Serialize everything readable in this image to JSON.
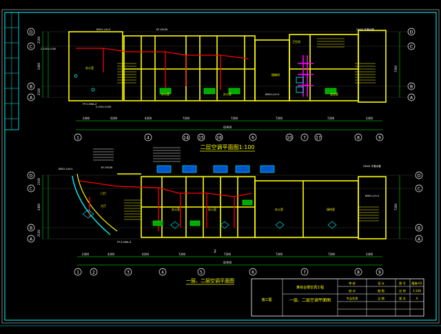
{
  "colors": {
    "background": "#000000",
    "frame": "#00ffff",
    "wall": "#ffff00",
    "dim": "#00ff00",
    "pipe_red": "#ff0000",
    "pipe_magenta": "#ff00ff",
    "fixture_cyan": "#00ffff",
    "text_white": "#ffffff"
  },
  "titles": {
    "upper_plan": "二层空调平面图1:100",
    "lower_plan": "一层、二层空调平面图"
  },
  "title_block": {
    "project_name": "某综合楼空调工程",
    "drawing_title": "一层、二层空调平面图",
    "stamp": "施工图",
    "rows": [
      [
        "审 核",
        "设 计",
        "图 号"
      ],
      [
        "校 对",
        "制 图",
        "比 例"
      ],
      [
        "专业负责",
        "日 期",
        "版 次"
      ]
    ],
    "values": [
      "暖施-02",
      "1:100",
      "A"
    ]
  },
  "upper": {
    "rows": [
      "D",
      "C",
      "B",
      "A"
    ],
    "cols": [
      "1",
      "4",
      "5",
      "6",
      "8",
      "9",
      "10",
      "11",
      "12"
    ],
    "col_lefts": [
      "14",
      "15",
      "16",
      "17"
    ],
    "dims": [
      "2400",
      "4200",
      "4200",
      "7200",
      "7200",
      "7200",
      "7200",
      "3300",
      "3300"
    ],
    "total": "42900",
    "side_dims": [
      "2100",
      "2400",
      "2100",
      "7200",
      "2400",
      "2100",
      "1800"
    ],
    "rooms": [
      "办公室",
      "办公室",
      "办公室",
      "会议室",
      "楼梯间",
      "卫生间"
    ],
    "notes": [
      "DN32-L/N-S",
      "KF-50GW",
      "DN40 冷凝水管",
      "2-150×1200",
      "FP-5.0WA-Z",
      "DN50-L/H-S",
      "2-150×1200"
    ]
  },
  "lower": {
    "rows": [
      "D",
      "C",
      "B",
      "A"
    ],
    "cols": [
      "1",
      "2",
      "3",
      "4",
      "5",
      "6",
      "7",
      "8",
      "9"
    ],
    "dims": [
      "2400",
      "4200",
      "4200",
      "7200",
      "7200",
      "7200",
      "7200",
      "3300"
    ],
    "total": "42900",
    "side_dims": [
      "2100",
      "2400",
      "2100",
      "7200"
    ],
    "rooms": [
      "门厅",
      "办公室",
      "办公室",
      "办公室",
      "接待室",
      "大厅"
    ],
    "notes": [
      "DN32-L/N-S",
      "KF-50GW",
      "DN40 冷凝水管",
      "FP-5.0WA-Z",
      "DN50-L/H-S"
    ],
    "center_label": "2"
  }
}
